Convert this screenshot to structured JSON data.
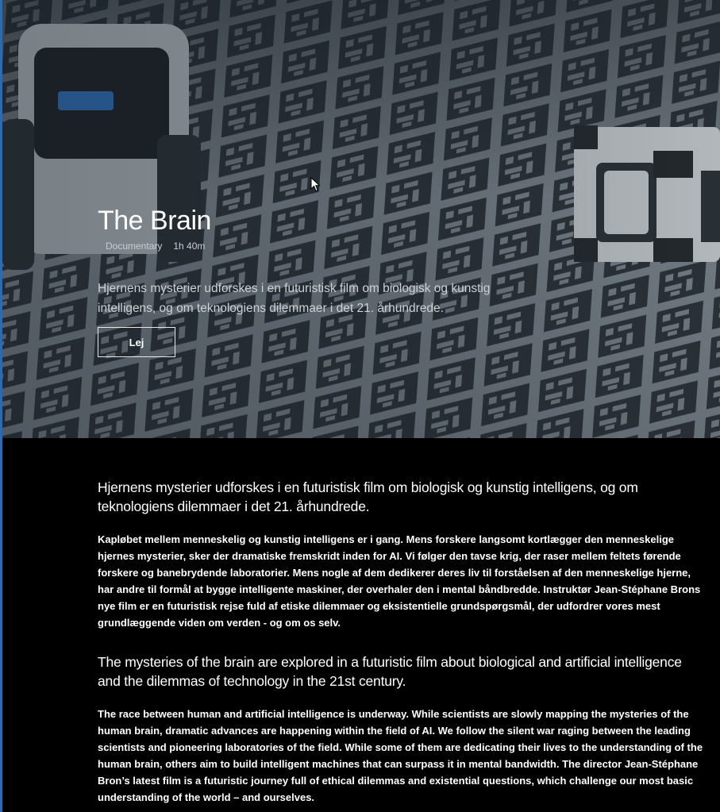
{
  "hero": {
    "title": "The Brain",
    "meta": {
      "genre": "Documentary",
      "duration": "1h 40m"
    },
    "tagline": "Hjernens mysterier udforskes i en futuristisk film om biologisk og kunstig intelligens, og om teknologiens dilemmaer i det 21. århundrede.",
    "rent_label": "Lej"
  },
  "description": {
    "danish": {
      "lead": "Hjernens mysterier udforskes i en futuristisk film om biologisk og kunstig intelligens, og om teknologiens dilemmaer i det 21. århundrede.",
      "body": "Kapløbet mellem menneskelig og kunstig intelligens er i gang. Mens forskere langsomt kortlægger den menneskelige hjernes mysterier, sker der dramatiske fremskridt inden for AI. Vi følger den tavse krig, der raser mellem feltets førende forskere og banebrydende laboratorier. Mens nogle af dem dedikerer deres liv til forståelsen af den menneskelige hjerne, har andre til formål at bygge intelligente maskiner, der overhaler den i mental båndbredde. Instruktør Jean-Stéphane Brons nye film er en futuristisk rejse fuld af etiske dilemmaer og eksistentielle grundspørgsmål, der udfordrer vores mest grundlæggende viden om verden - og om os selv."
    },
    "english": {
      "lead": "The mysteries of the brain are explored in a futuristic film about biological and artificial intelligence and the dilemmas of technology in the 21st century.",
      "body": "The race between human and artificial intelligence is underway. While scientists are slowly mapping the mysteries of the human brain, dramatic advances are happening within the field of AI. We follow the silent war raging between the leading scientists and pioneering laboratories of the field. While some of them are dedicating their lives to the understanding of the human brain, others aim to build intelligent machines that can surpass it in mental bandwidth. The director Jean-Stéphane Bron’s latest film is a futuristic journey full of ethical dilemmas and existential questions, which challenge our most basic understanding of the world – and ourselves."
    }
  },
  "colors": {
    "page_background": "#000000",
    "hero_tint": "#5a6670",
    "button_border": "#e8e8e8",
    "left_edge_accent": "#2b6bb3"
  },
  "icons": {
    "cursor": "arrow-cursor-icon"
  }
}
